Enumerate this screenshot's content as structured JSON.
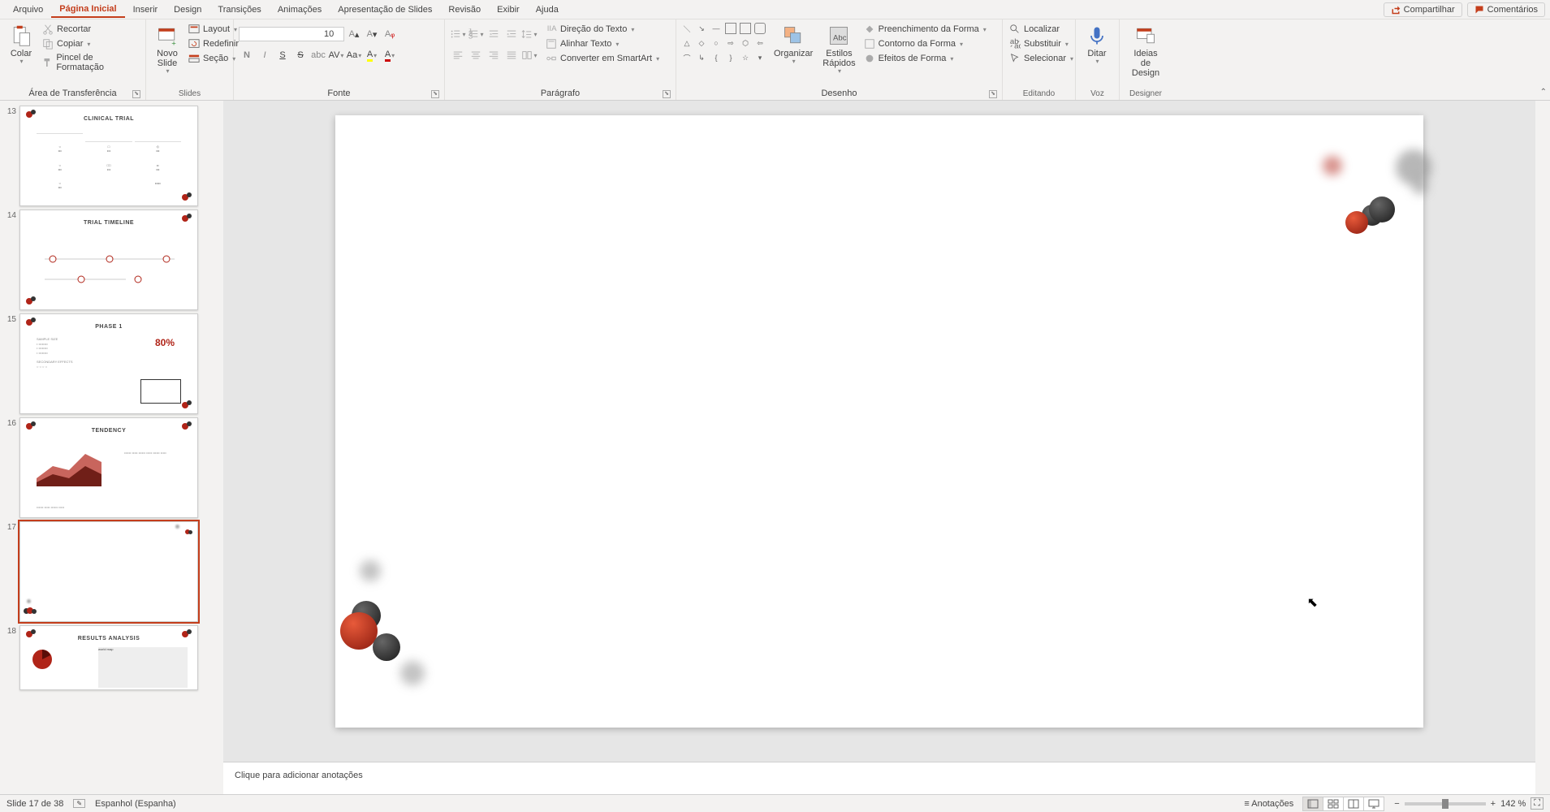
{
  "menu": {
    "arquivo": "Arquivo",
    "pagina_inicial": "Página Inicial",
    "inserir": "Inserir",
    "design": "Design",
    "transicoes": "Transições",
    "animacoes": "Animações",
    "apresentacao": "Apresentação de Slides",
    "revisao": "Revisão",
    "exibir": "Exibir",
    "ajuda": "Ajuda"
  },
  "topright": {
    "compartilhar": "Compartilhar",
    "comentarios": "Comentários"
  },
  "ribbon": {
    "clipboard": {
      "label": "Área de Transferência",
      "colar": "Colar",
      "recortar": "Recortar",
      "copiar": "Copiar",
      "pincel": "Pincel de Formatação"
    },
    "slides": {
      "label": "Slides",
      "novo": "Novo\nSlide",
      "layout": "Layout",
      "redefinir": "Redefinir",
      "secao": "Seção"
    },
    "fonte": {
      "label": "Fonte",
      "size": "10",
      "bold": "N",
      "italic": "I",
      "underline": "S",
      "strike": "S",
      "shadow": "abc",
      "spacing": "AV",
      "case": "Aa"
    },
    "paragrafo": {
      "label": "Parágrafo",
      "direcao": "Direção do Texto",
      "alinhar": "Alinhar Texto",
      "smartart": "Converter em SmartArt"
    },
    "desenho": {
      "label": "Desenho",
      "organizar": "Organizar",
      "estilos": "Estilos\nRápidos",
      "preenchimento": "Preenchimento da Forma",
      "contorno": "Contorno da Forma",
      "efeitos": "Efeitos de Forma"
    },
    "editando": {
      "label": "Editando",
      "localizar": "Localizar",
      "substituir": "Substituir",
      "selecionar": "Selecionar"
    },
    "voz": {
      "label": "Voz",
      "ditar": "Ditar"
    },
    "designer": {
      "label": "Designer",
      "ideias": "Ideias de\nDesign"
    }
  },
  "thumbs": [
    {
      "num": "13",
      "title": "CLINICAL TRIAL"
    },
    {
      "num": "14",
      "title": "TRIAL TIMELINE"
    },
    {
      "num": "15",
      "title": "PHASE 1",
      "extra": "80%"
    },
    {
      "num": "16",
      "title": "TENDENCY"
    },
    {
      "num": "17",
      "title": "",
      "selected": true
    },
    {
      "num": "18",
      "title": "RESULTS ANALYSIS"
    }
  ],
  "notes": {
    "placeholder": "Clique para adicionar anotações"
  },
  "status": {
    "slide": "Slide 17 de 38",
    "lang": "Espanhol (Espanha)",
    "anotacoes": "Anotações",
    "zoom": "142 %"
  }
}
